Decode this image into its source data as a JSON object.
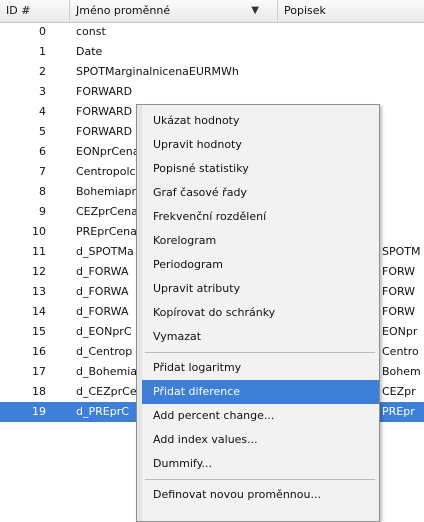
{
  "header": {
    "id_label": "ID #",
    "name_label": "Jméno proměnné",
    "description_label": "Popisek",
    "sort_icon": "chevron-down-icon"
  },
  "variables": [
    {
      "id": "0",
      "name": "const",
      "label": ""
    },
    {
      "id": "1",
      "name": "Date",
      "label": ""
    },
    {
      "id": "2",
      "name": "SPOTMarginalnicenaEURMWh",
      "label": ""
    },
    {
      "id": "3",
      "name": "FORWARD",
      "label": ""
    },
    {
      "id": "4",
      "name": "FORWARD",
      "label": ""
    },
    {
      "id": "5",
      "name": "FORWARD",
      "label": ""
    },
    {
      "id": "6",
      "name": "EONprCena",
      "label": ""
    },
    {
      "id": "7",
      "name": "Centropolc",
      "label": ""
    },
    {
      "id": "8",
      "name": "Bohemiapr",
      "label": ""
    },
    {
      "id": "9",
      "name": "CEZprCena",
      "label": ""
    },
    {
      "id": "10",
      "name": "PREprCena",
      "label": ""
    },
    {
      "id": "11",
      "name": "d_SPOTMa",
      "label": "SPOTM"
    },
    {
      "id": "12",
      "name": "d_FORWA",
      "label": "FORW"
    },
    {
      "id": "13",
      "name": "d_FORWA",
      "label": "FORW"
    },
    {
      "id": "14",
      "name": "d_FORWA",
      "label": "FORW"
    },
    {
      "id": "15",
      "name": "d_EONprC",
      "label": "EONpr"
    },
    {
      "id": "16",
      "name": "d_Centrop",
      "label": "Centro"
    },
    {
      "id": "17",
      "name": "d_Bohemia",
      "label": "Bohem"
    },
    {
      "id": "18",
      "name": "d_CEZprCe",
      "label": "CEZpr"
    },
    {
      "id": "19",
      "name": "d_PREprC",
      "label": "PREpr"
    }
  ],
  "selected_row": "19",
  "context_menu": {
    "items": [
      "Ukázat hodnoty",
      "Upravit hodnoty",
      "Popisné statistiky",
      "Graf časové řady",
      "Frekvenční rozdělení",
      "Korelogram",
      "Periodogram",
      "Upravit atributy",
      "Kopírovat do schránky",
      "Vymazat",
      "Přidat logaritmy",
      "Přidat diference",
      "Add percent change...",
      "Add index values...",
      "Dummify...",
      "Definovat novou proměnnou..."
    ],
    "highlighted": "Přidat diference"
  },
  "colors": {
    "selection": "#3d7fd6",
    "menu_background": "#f2f2f2"
  }
}
